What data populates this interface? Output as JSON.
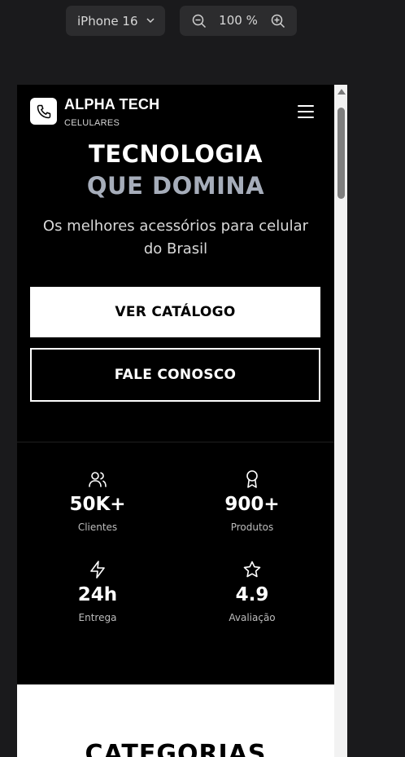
{
  "toolbar": {
    "device_label": "iPhone 16",
    "zoom_value": "100 %"
  },
  "site": {
    "brand": "ALPHA TECH",
    "brand_sub": "CELULARES",
    "hero_line1": "TECNOLOGIA",
    "hero_line2": "QUE DOMINA",
    "hero_subtitle": "Os melhores acessórios para celular do Brasil",
    "cta_primary": "VER CATÁLOGO",
    "cta_secondary": "FALE CONOSCO",
    "stats": [
      {
        "icon": "users-icon",
        "value": "50K+",
        "label": "Clientes"
      },
      {
        "icon": "award-icon",
        "value": "900+",
        "label": "Produtos"
      },
      {
        "icon": "zap-icon",
        "value": "24h",
        "label": "Entrega"
      },
      {
        "icon": "star-icon",
        "value": "4.9",
        "label": "Avaliação"
      }
    ],
    "categories_title": "CATEGORIAS"
  },
  "colors": {
    "background": "#1a1a1c",
    "site_bg": "#000000",
    "accent_gray": "#a6adba",
    "white": "#ffffff"
  }
}
